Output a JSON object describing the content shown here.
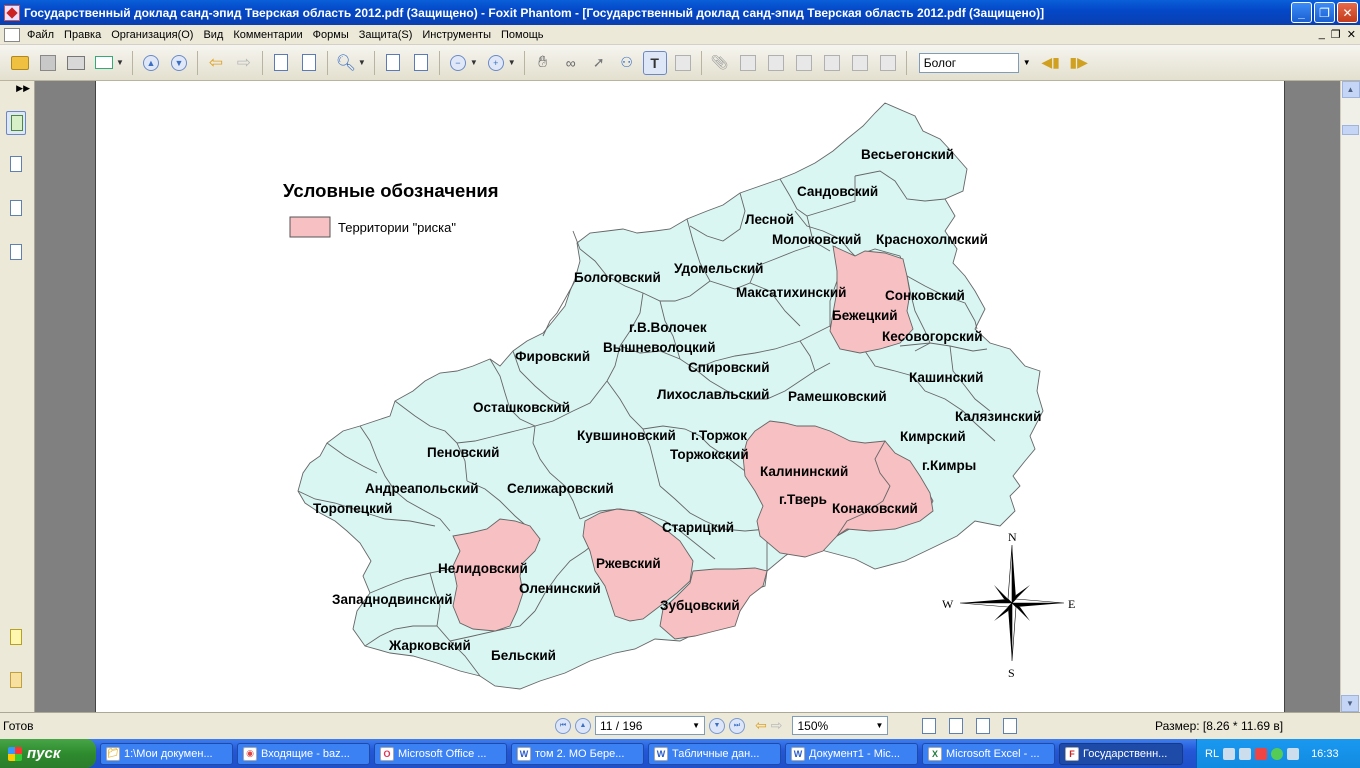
{
  "window": {
    "title": "Государственный доклад санд-эпид Тверская область 2012.pdf (Защищено) - Foxit Phantom - [Государственный доклад санд-эпид Тверская область 2012.pdf (Защищено)]",
    "controls": {
      "minimize": "_",
      "restore": "❐",
      "close": "✕"
    }
  },
  "menu": {
    "items": [
      "Файл",
      "Правка",
      "Организация(O)",
      "Вид",
      "Комментарии",
      "Формы",
      "Защита(S)",
      "Инструменты",
      "Помощь"
    ],
    "mdi": {
      "minimize": "_",
      "restore": "❐",
      "close": "✕"
    }
  },
  "toolbar": {
    "search_value": "Болог"
  },
  "statusbar": {
    "ready": "Готов",
    "page_value": "11 / 196",
    "zoom_value": "150%",
    "size_label": "Размер: [8.26 * 11.69 в]"
  },
  "map": {
    "legend": {
      "title": "Условные обозначения",
      "risk_label": "Территории \"риска\""
    },
    "compass": {
      "n": "N",
      "s": "S",
      "e": "E",
      "w": "W"
    },
    "colors": {
      "normal": "#d9f6f2",
      "risk": "#f7c0c3",
      "border": "#666666"
    },
    "districts": [
      {
        "name": "Весьегонский",
        "risk": false
      },
      {
        "name": "Сандовский",
        "risk": false
      },
      {
        "name": "Лесной",
        "risk": false
      },
      {
        "name": "Молоковский",
        "risk": false
      },
      {
        "name": "Краснохолмский",
        "risk": false
      },
      {
        "name": "Бологовский",
        "risk": false
      },
      {
        "name": "Удомельский",
        "risk": false
      },
      {
        "name": "Максатихинский",
        "risk": false
      },
      {
        "name": "Сонковский",
        "risk": false
      },
      {
        "name": "Бежецкий",
        "risk": true
      },
      {
        "name": "г.В.Волочек",
        "risk": false
      },
      {
        "name": "Вышневолоцкий",
        "risk": false
      },
      {
        "name": "Кесовогорский",
        "risk": false
      },
      {
        "name": "Фировский",
        "risk": false
      },
      {
        "name": "Спировский",
        "risk": false
      },
      {
        "name": "Кашинский",
        "risk": false
      },
      {
        "name": "Лихославльский",
        "risk": false
      },
      {
        "name": "Рамешковский",
        "risk": false
      },
      {
        "name": "Осташковский",
        "risk": false
      },
      {
        "name": "Калязинский",
        "risk": false
      },
      {
        "name": "Кувшиновский",
        "risk": false
      },
      {
        "name": "г.Торжок",
        "risk": false
      },
      {
        "name": "Кимрский",
        "risk": false
      },
      {
        "name": "Пеновский",
        "risk": false
      },
      {
        "name": "Торжокский",
        "risk": false
      },
      {
        "name": "г.Кимры",
        "risk": false
      },
      {
        "name": "Калининский",
        "risk": true
      },
      {
        "name": "Андреапольский",
        "risk": false
      },
      {
        "name": "Селижаровский",
        "risk": false
      },
      {
        "name": "г.Тверь",
        "risk": true
      },
      {
        "name": "Торопецкий",
        "risk": false
      },
      {
        "name": "Конаковский",
        "risk": true
      },
      {
        "name": "Старицкий",
        "risk": false
      },
      {
        "name": "Нелидовский",
        "risk": true
      },
      {
        "name": "Ржевский",
        "risk": true
      },
      {
        "name": "Оленинский",
        "risk": false
      },
      {
        "name": "Западнодвинский",
        "risk": false
      },
      {
        "name": "Зубцовский",
        "risk": true
      },
      {
        "name": "Жарковский",
        "risk": false
      },
      {
        "name": "Бельский",
        "risk": false
      }
    ]
  },
  "taskbar": {
    "start": "пуск",
    "tasks": [
      {
        "label": "1:\\Мои докумен...",
        "icon": "folder-icon",
        "active": false
      },
      {
        "label": "Входящие - baz...",
        "icon": "chrome-icon",
        "active": false
      },
      {
        "label": "Microsoft Office ...",
        "icon": "office-icon",
        "active": false
      },
      {
        "label": "том 2. МО Бере...",
        "icon": "word-icon",
        "active": false
      },
      {
        "label": "Табличные дан...",
        "icon": "word-icon",
        "active": false
      },
      {
        "label": "Документ1 - Mic...",
        "icon": "word-icon",
        "active": false
      },
      {
        "label": "Microsoft Excel - ...",
        "icon": "excel-icon",
        "active": false
      },
      {
        "label": "Государственн...",
        "icon": "foxit-icon",
        "active": true
      }
    ],
    "tray": {
      "lang": "RL",
      "clock": "16:33"
    }
  }
}
